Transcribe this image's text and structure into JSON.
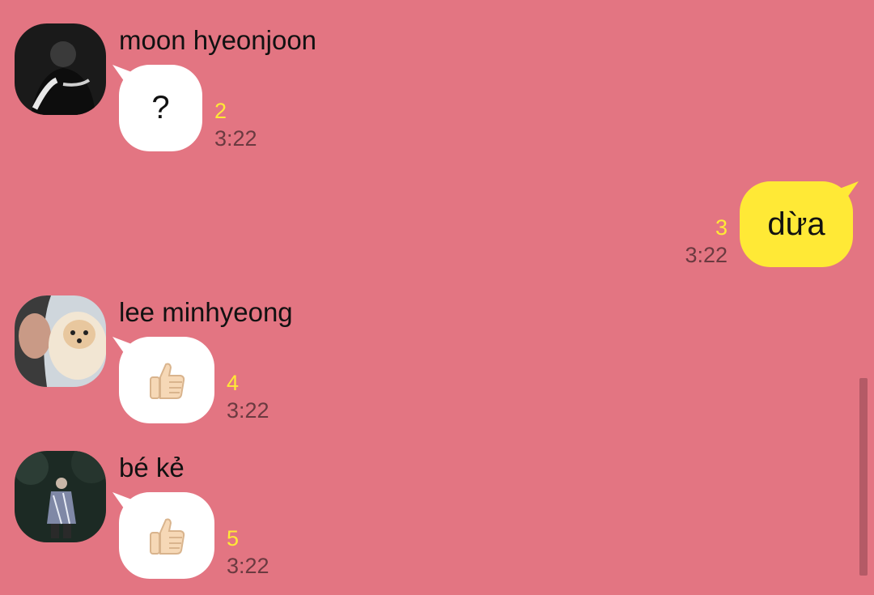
{
  "messages": [
    {
      "sender": "moon hyeonjoon",
      "text": "?",
      "unread": "2",
      "time": "3:22",
      "direction": "incoming"
    },
    {
      "sender": "",
      "text": "dừa",
      "unread": "3",
      "time": "3:22",
      "direction": "outgoing"
    },
    {
      "sender": "lee minhyeong",
      "emoji": "thumbs-up",
      "unread": "4",
      "time": "3:22",
      "direction": "incoming"
    },
    {
      "sender": "bé kẻ",
      "emoji": "thumbs-up",
      "unread": "5",
      "time": "3:22",
      "direction": "incoming"
    }
  ],
  "colors": {
    "background": "#e37582",
    "incoming_bubble": "#ffffff",
    "outgoing_bubble": "#ffe936",
    "unread_count": "#ffe936",
    "timestamp": "#6b3a40"
  }
}
